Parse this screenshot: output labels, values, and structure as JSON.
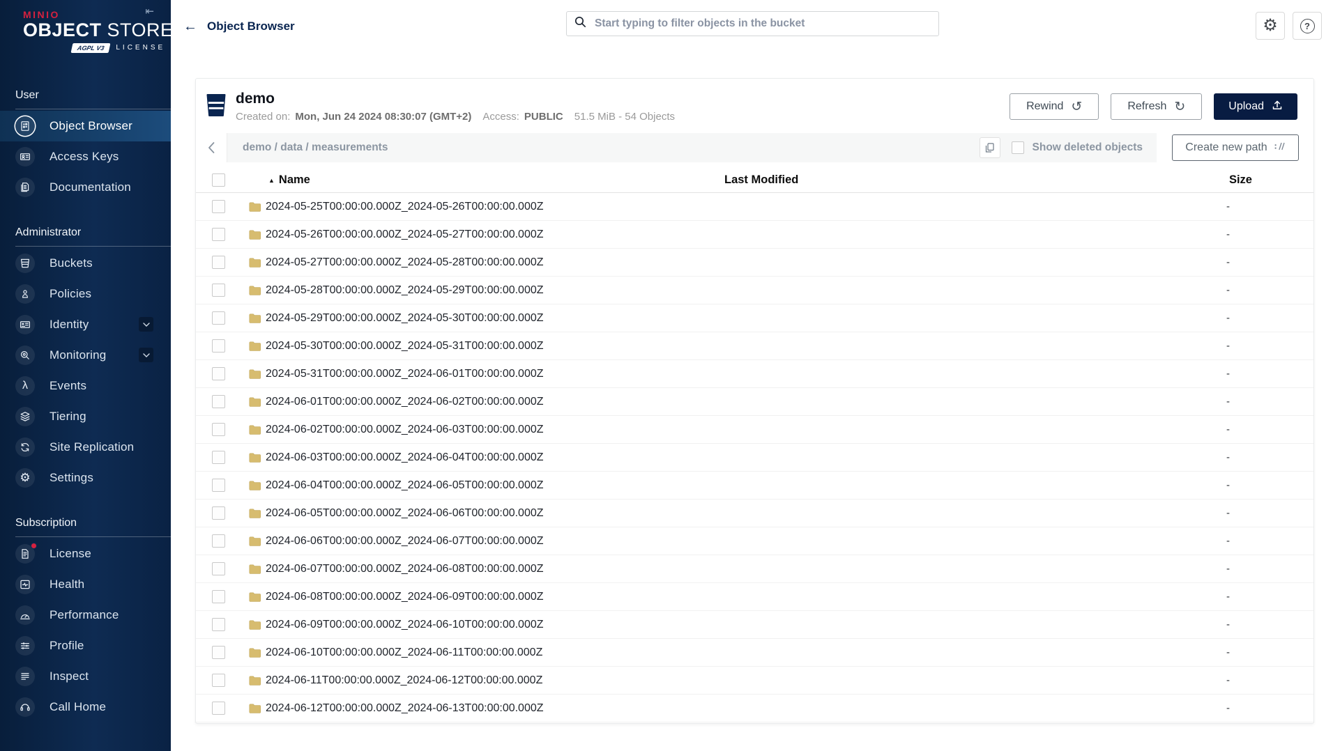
{
  "sidebar": {
    "logo": {
      "brand": "MINIO",
      "product_bold": "OBJECT",
      "product_light": "STORE",
      "license_badge": "AGPL V3",
      "license_label": "LICENSE"
    },
    "sections": [
      {
        "title": "User",
        "items": [
          {
            "label": "Object Browser",
            "icon": "object-browser-icon",
            "active": true
          },
          {
            "label": "Access Keys",
            "icon": "access-keys-icon"
          },
          {
            "label": "Documentation",
            "icon": "documentation-icon"
          }
        ]
      },
      {
        "title": "Administrator",
        "items": [
          {
            "label": "Buckets",
            "icon": "buckets-icon"
          },
          {
            "label": "Policies",
            "icon": "policies-icon"
          },
          {
            "label": "Identity",
            "icon": "identity-icon",
            "expandable": true
          },
          {
            "label": "Monitoring",
            "icon": "monitoring-icon",
            "expandable": true
          },
          {
            "label": "Events",
            "icon": "events-icon"
          },
          {
            "label": "Tiering",
            "icon": "tiering-icon"
          },
          {
            "label": "Site Replication",
            "icon": "site-replication-icon"
          },
          {
            "label": "Settings",
            "icon": "settings-icon"
          }
        ]
      },
      {
        "title": "Subscription",
        "items": [
          {
            "label": "License",
            "icon": "license-icon",
            "badge": true
          },
          {
            "label": "Health",
            "icon": "health-icon"
          },
          {
            "label": "Performance",
            "icon": "performance-icon"
          },
          {
            "label": "Profile",
            "icon": "profile-icon"
          },
          {
            "label": "Inspect",
            "icon": "inspect-icon"
          },
          {
            "label": "Call Home",
            "icon": "call-home-icon"
          }
        ]
      }
    ]
  },
  "header": {
    "back_label": "Object Browser",
    "search_placeholder": "Start typing to filter objects in the bucket",
    "icons": {
      "search": "magnifier",
      "settings": "gear",
      "help": "question-circle"
    }
  },
  "bucket": {
    "name": "demo",
    "created_label": "Created on:",
    "created_value": "Mon, Jun 24 2024 08:30:07 (GMT+2)",
    "access_label": "Access:",
    "access_value": "PUBLIC",
    "usage": "51.5 MiB - 54 Objects",
    "actions": {
      "rewind": "Rewind",
      "refresh": "Refresh",
      "upload": "Upload"
    }
  },
  "browse": {
    "path": "demo / data / measurements",
    "show_deleted_label": "Show deleted objects",
    "create_path_label": "Create new path"
  },
  "table": {
    "columns": {
      "name": "Name",
      "last_modified": "Last Modified",
      "size": "Size"
    },
    "sort": {
      "column": "Name",
      "direction": "ascending"
    },
    "rows": [
      {
        "name": "2024-05-25T00:00:00.000Z_2024-05-26T00:00:00.000Z",
        "size": "-"
      },
      {
        "name": "2024-05-26T00:00:00.000Z_2024-05-27T00:00:00.000Z",
        "size": "-"
      },
      {
        "name": "2024-05-27T00:00:00.000Z_2024-05-28T00:00:00.000Z",
        "size": "-"
      },
      {
        "name": "2024-05-28T00:00:00.000Z_2024-05-29T00:00:00.000Z",
        "size": "-"
      },
      {
        "name": "2024-05-29T00:00:00.000Z_2024-05-30T00:00:00.000Z",
        "size": "-"
      },
      {
        "name": "2024-05-30T00:00:00.000Z_2024-05-31T00:00:00.000Z",
        "size": "-"
      },
      {
        "name": "2024-05-31T00:00:00.000Z_2024-06-01T00:00:00.000Z",
        "size": "-"
      },
      {
        "name": "2024-06-01T00:00:00.000Z_2024-06-02T00:00:00.000Z",
        "size": "-"
      },
      {
        "name": "2024-06-02T00:00:00.000Z_2024-06-03T00:00:00.000Z",
        "size": "-"
      },
      {
        "name": "2024-06-03T00:00:00.000Z_2024-06-04T00:00:00.000Z",
        "size": "-"
      },
      {
        "name": "2024-06-04T00:00:00.000Z_2024-06-05T00:00:00.000Z",
        "size": "-"
      },
      {
        "name": "2024-06-05T00:00:00.000Z_2024-06-06T00:00:00.000Z",
        "size": "-"
      },
      {
        "name": "2024-06-06T00:00:00.000Z_2024-06-07T00:00:00.000Z",
        "size": "-"
      },
      {
        "name": "2024-06-07T00:00:00.000Z_2024-06-08T00:00:00.000Z",
        "size": "-"
      },
      {
        "name": "2024-06-08T00:00:00.000Z_2024-06-09T00:00:00.000Z",
        "size": "-"
      },
      {
        "name": "2024-06-09T00:00:00.000Z_2024-06-10T00:00:00.000Z",
        "size": "-"
      },
      {
        "name": "2024-06-10T00:00:00.000Z_2024-06-11T00:00:00.000Z",
        "size": "-"
      },
      {
        "name": "2024-06-11T00:00:00.000Z_2024-06-12T00:00:00.000Z",
        "size": "-"
      },
      {
        "name": "2024-06-12T00:00:00.000Z_2024-06-13T00:00:00.000Z",
        "size": "-"
      }
    ]
  },
  "colors": {
    "brand_red": "#D5213F",
    "navy": "#081C42",
    "folder_yellow": "#D7BC6F"
  }
}
